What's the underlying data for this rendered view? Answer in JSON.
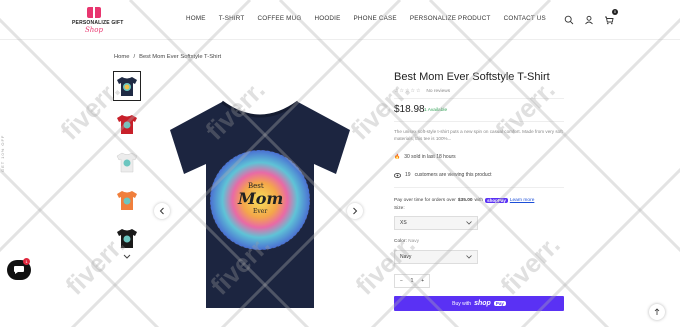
{
  "brand": {
    "line1": "PERSONALIZE GIFT",
    "line2": "Shop",
    "accent": "#e8366f"
  },
  "nav": {
    "items": [
      "HOME",
      "T-SHIRT",
      "COFFEE MUG",
      "HOODIE",
      "PHONE CASE",
      "PERSONALIZE PRODUCT",
      "CONTACT US"
    ]
  },
  "header_icons": {
    "search": "search-icon",
    "account": "user-icon",
    "cart": "cart-icon",
    "cart_count": "0"
  },
  "breadcrumb": {
    "home": "Home",
    "separator": "/",
    "current": "Best Mom Ever Softstyle T-Shirt"
  },
  "gallery": {
    "thumb_colors": [
      "#1f2a44",
      "#c8202a",
      "#e8e8e8",
      "#f07f3c",
      "#1a1a1a"
    ],
    "shirt_color": "#1c2540",
    "graphic_text_1": "Best",
    "graphic_text_2": "Mom",
    "graphic_text_3": "Ever"
  },
  "product": {
    "title": "Best Mom Ever Softstyle T-Shirt",
    "reviews": "No reviews",
    "price": "$18.98",
    "availability": "1 Available",
    "description": "The unisex soft-style t-shirt puts a new spin on casual comfort. Made from very soft materials, this tee is 100%...",
    "sold_text": "30 sold in last 18 hours",
    "viewing_text": "customers are viewing this product",
    "viewing_count": "19",
    "paylater_text": "Pay over time for orders over",
    "paylater_amount": "$35.00",
    "paylater_with": "with",
    "shop_pay_mini": "shop",
    "shop_pay_suffix": "Pay",
    "learn_more": "Learn more",
    "size_label": "Size:",
    "size_value": "XS",
    "size_selected": "XS",
    "color_label": "Color:",
    "color_value": "Navy",
    "color_selected": "Navy",
    "quantity": "1",
    "qty_minus": "−",
    "qty_plus": "+",
    "buy_prefix": "Buy with",
    "buy_shop": "shop",
    "buy_pay": "Pay",
    "buy_color": "#5a31f4"
  },
  "side_tag": "GET 10% OFF",
  "chat": {
    "badge": "1"
  },
  "watermark": "fiverr."
}
